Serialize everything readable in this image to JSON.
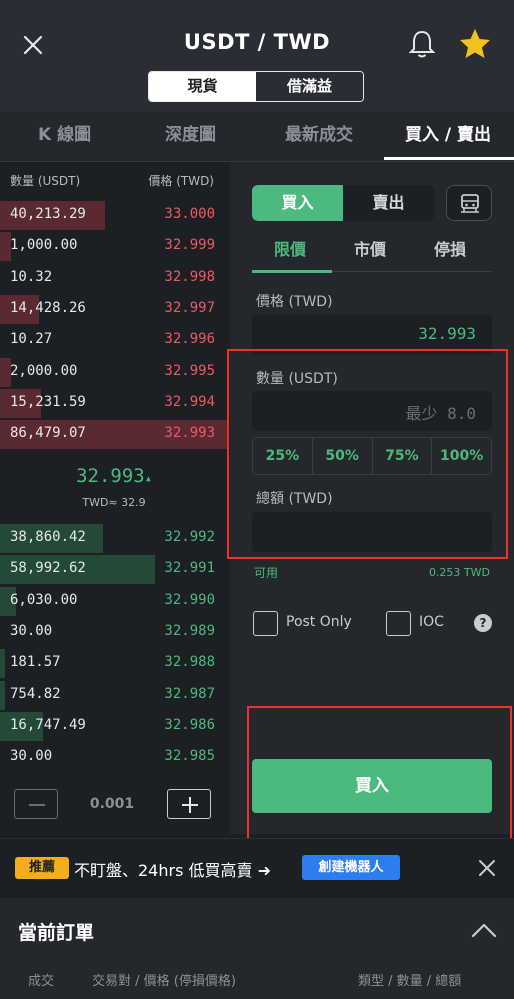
{
  "header": {
    "title": "USDT / TWD",
    "modes": [
      "現貨",
      "借滿益"
    ]
  },
  "tabs": [
    "K 線圖",
    "深度圖",
    "最新成交",
    "買入 / 賣出"
  ],
  "orderbook": {
    "qty_header": "數量 (USDT)",
    "price_header": "價格 (TWD)",
    "asks": [
      {
        "qty": "40,213.29",
        "price": "33.000",
        "depth": 0.46
      },
      {
        "qty": "1,000.00",
        "price": "32.999",
        "depth": 0.05
      },
      {
        "qty": "10.32",
        "price": "32.998",
        "depth": 0.0
      },
      {
        "qty": "14,428.26",
        "price": "32.997",
        "depth": 0.17
      },
      {
        "qty": "10.27",
        "price": "32.996",
        "depth": 0.0
      },
      {
        "qty": "2,000.00",
        "price": "32.995",
        "depth": 0.05
      },
      {
        "qty": "15,231.59",
        "price": "32.994",
        "depth": 0.18
      },
      {
        "qty": "86,479.07",
        "price": "32.993",
        "depth": 1.0
      }
    ],
    "mid_price": "32.993",
    "mid_arrow": "▴",
    "mid_approx": "TWD≈ 32.9",
    "bids": [
      {
        "qty": "38,860.42",
        "price": "32.992",
        "depth": 0.45
      },
      {
        "qty": "58,992.62",
        "price": "32.991",
        "depth": 0.68
      },
      {
        "qty": "6,030.00",
        "price": "32.990",
        "depth": 0.07
      },
      {
        "qty": "30.00",
        "price": "32.989",
        "depth": 0.0
      },
      {
        "qty": "181.57",
        "price": "32.988",
        "depth": 0.02
      },
      {
        "qty": "754.82",
        "price": "32.987",
        "depth": 0.02
      },
      {
        "qty": "16,747.49",
        "price": "32.986",
        "depth": 0.19
      },
      {
        "qty": "30.00",
        "price": "32.985",
        "depth": 0.0
      }
    ],
    "step_value": "0.001"
  },
  "form": {
    "buy_label": "買入",
    "sell_label": "賣出",
    "order_types": [
      "限價",
      "市價",
      "停損"
    ],
    "price_label": "價格 (TWD)",
    "price_value": "32.993",
    "qty_label": "數量 (USDT)",
    "qty_placeholder": "最少 8.0",
    "percents": [
      "25%",
      "50%",
      "75%",
      "100%"
    ],
    "total_label": "總額 (TWD)",
    "available_label": "可用",
    "available_value": "0.253 TWD",
    "post_only_label": "Post Only",
    "ioc_label": "IOC",
    "help_glyph": "?",
    "submit_label": "買入"
  },
  "promo": {
    "badge": "推薦",
    "text": "不盯盤、24hrs 低買高賣 ➜",
    "button": "創建機器人"
  },
  "orders": {
    "title": "當前訂單",
    "columns": [
      "成交",
      "交易對 / 價格 (停損價格)",
      "類型 / 數量 / 總額"
    ]
  },
  "colors": {
    "buy_green": "#4cba7f",
    "sell_red": "#ef5a62",
    "promo_blue": "#2d7df0",
    "badge_yellow": "#f3ad1e",
    "annotation_red": "#e8332a"
  }
}
